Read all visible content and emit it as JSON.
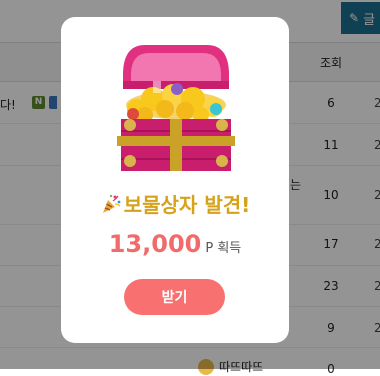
{
  "background": {
    "write_button_label": "글",
    "views_header": "조회",
    "rows": [
      {
        "title_fragment": "다!",
        "badge": "N",
        "views": "6",
        "edge": "2"
      },
      {
        "title_fragment": "",
        "badge": "",
        "views": "11",
        "edge": "2"
      },
      {
        "title_fragment": "는",
        "badge": "",
        "views": "10",
        "edge": "2"
      },
      {
        "title_fragment": "",
        "badge": "",
        "views": "17",
        "edge": "2"
      },
      {
        "title_fragment": "",
        "badge": "",
        "views": "23",
        "edge": "2"
      },
      {
        "title_fragment": "",
        "badge": "",
        "views": "9",
        "edge": "2"
      },
      {
        "title_fragment": "",
        "badge": "",
        "views": "0",
        "edge": ""
      }
    ],
    "last_row_author": "따뜨따뜨"
  },
  "modal": {
    "title": "보물상자 발견!",
    "points_value": "13,000",
    "points_unit": "P 획득",
    "button_label": "받기"
  },
  "colors": {
    "title": "#d6a21c",
    "points": "#f26b6b",
    "button": "#f97070",
    "chest_body": "#c91d6e",
    "chest_lid": "#e83e8c",
    "gold": "#f8c81c",
    "band": "#c9a227"
  },
  "icons": {
    "write": "pencil-icon",
    "title": "party-popper-icon",
    "illustration": "treasure-chest-icon"
  }
}
